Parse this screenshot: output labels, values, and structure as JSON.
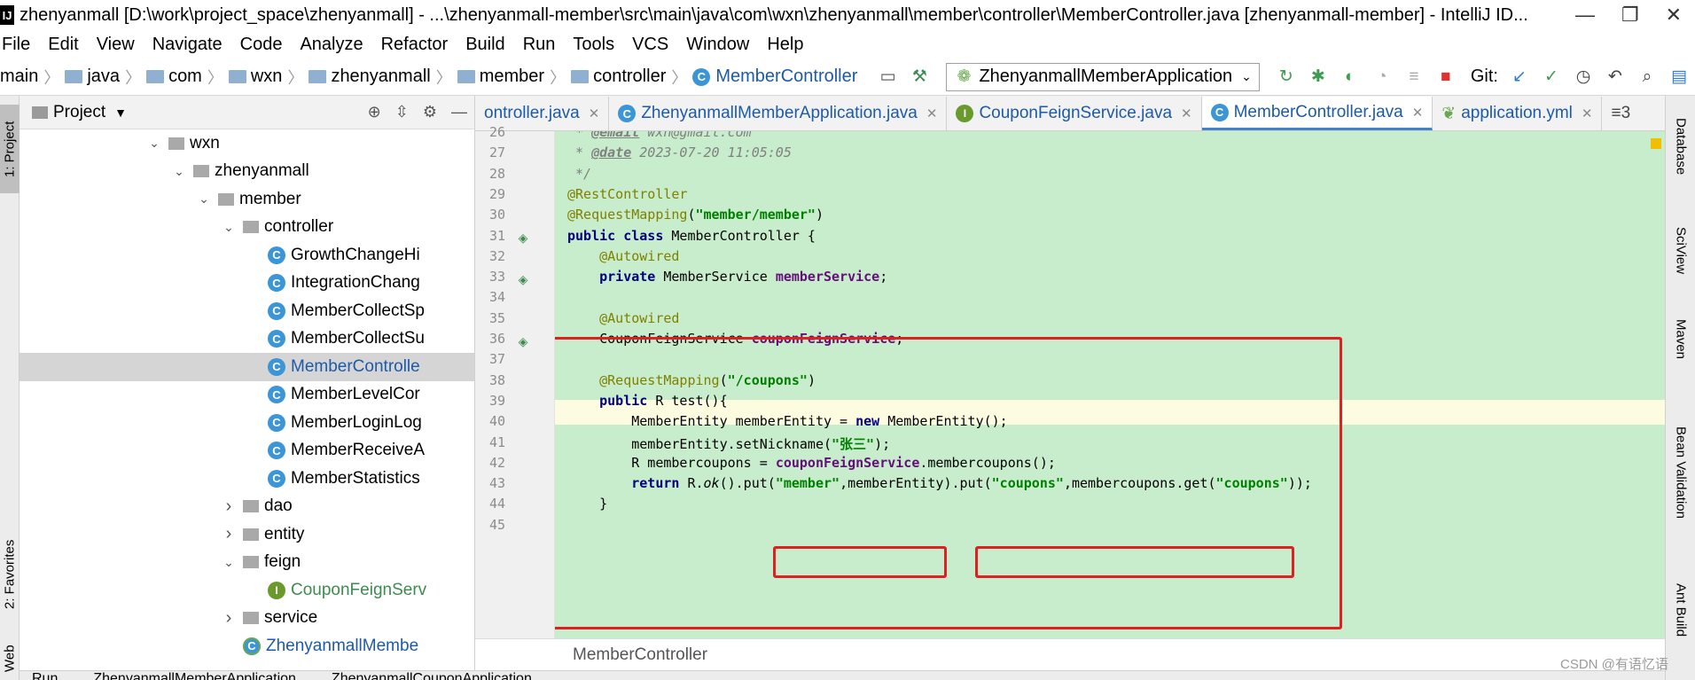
{
  "window": {
    "app_icon": "IJ",
    "title": "zhenyanmall [D:\\work\\project_space\\zhenyanmall] - ...\\zhenyanmall-member\\src\\main\\java\\com\\wxn\\zhenyanmall\\member\\controller\\MemberController.java [zhenyanmall-member] - IntelliJ ID...",
    "minimize": "—",
    "restore": "❐",
    "close": "✕"
  },
  "menu": [
    "File",
    "Edit",
    "View",
    "Navigate",
    "Code",
    "Analyze",
    "Refactor",
    "Build",
    "Run",
    "Tools",
    "VCS",
    "Window",
    "Help"
  ],
  "breadcrumbs": [
    "main",
    "java",
    "com",
    "wxn",
    "zhenyanmall",
    "member",
    "controller",
    "MemberController"
  ],
  "run_config": "ZhenyanmallMemberApplication",
  "git_label": "Git:",
  "project_panel": {
    "title": "Project",
    "tree": [
      {
        "label": "wxn",
        "indent": 1,
        "arrow": "down",
        "icon": "folder"
      },
      {
        "label": "zhenyanmall",
        "indent": 2,
        "arrow": "down",
        "icon": "folder"
      },
      {
        "label": "member",
        "indent": 3,
        "arrow": "down",
        "icon": "folder"
      },
      {
        "label": "controller",
        "indent": 4,
        "arrow": "down",
        "icon": "folder"
      },
      {
        "label": "GrowthChangeHi",
        "indent": 5,
        "arrow": "",
        "icon": "class"
      },
      {
        "label": "IntegrationChang",
        "indent": 5,
        "arrow": "",
        "icon": "class"
      },
      {
        "label": "MemberCollectSp",
        "indent": 5,
        "arrow": "",
        "icon": "class"
      },
      {
        "label": "MemberCollectSu",
        "indent": 5,
        "arrow": "",
        "icon": "class"
      },
      {
        "label": "MemberControlle",
        "indent": 5,
        "arrow": "",
        "icon": "class",
        "selected": true
      },
      {
        "label": "MemberLevelCor",
        "indent": 5,
        "arrow": "",
        "icon": "class"
      },
      {
        "label": "MemberLoginLog",
        "indent": 5,
        "arrow": "",
        "icon": "class"
      },
      {
        "label": "MemberReceiveA",
        "indent": 5,
        "arrow": "",
        "icon": "class"
      },
      {
        "label": "MemberStatistics",
        "indent": 5,
        "arrow": "",
        "icon": "class"
      },
      {
        "label": "dao",
        "indent": 4,
        "arrow": "right",
        "icon": "folder"
      },
      {
        "label": "entity",
        "indent": 4,
        "arrow": "right",
        "icon": "folder"
      },
      {
        "label": "feign",
        "indent": 4,
        "arrow": "down",
        "icon": "folder"
      },
      {
        "label": "CouponFeignServ",
        "indent": 5,
        "arrow": "",
        "icon": "interface"
      },
      {
        "label": "service",
        "indent": 4,
        "arrow": "right",
        "icon": "folder"
      },
      {
        "label": "ZhenyanmallMembe",
        "indent": 4,
        "arrow": "",
        "icon": "springclass"
      }
    ]
  },
  "left_tabs": {
    "project": "1: Project",
    "favorites": "2: Favorites",
    "web": "Web"
  },
  "editor_tabs": [
    {
      "label": "ontroller.java",
      "icon": "none",
      "active": false
    },
    {
      "label": "ZhenyanmallMemberApplication.java",
      "icon": "class",
      "active": false
    },
    {
      "label": "CouponFeignService.java",
      "icon": "interface",
      "active": false
    },
    {
      "label": "MemberController.java",
      "icon": "class",
      "active": true
    },
    {
      "label": "application.yml",
      "icon": "spring",
      "active": false
    }
  ],
  "tab_overflow": "≡3",
  "right_tabs": [
    "Database",
    "SciView",
    "Maven",
    "Bean Validation",
    "Ant Build"
  ],
  "code_lines": [
    {
      "n": "26",
      "html": "<span class=\"cmt\"> * <b><u>@email</u></b> wxn@gmail.com</span>"
    },
    {
      "n": "27",
      "html": "<span class=\"cmt\"> * <b><u>@date</u></b> 2023-07-20 11:05:05</span>"
    },
    {
      "n": "28",
      "html": "<span class=\"cmt\"> */</span>"
    },
    {
      "n": "29",
      "html": "<span class=\"ann\">@RestController</span>"
    },
    {
      "n": "30",
      "html": "<span class=\"ann\">@RequestMapping</span>(<span class=\"str\">\"member/member\"</span>)"
    },
    {
      "n": "31",
      "html": "<span class=\"kw\">public class</span> MemberController {"
    },
    {
      "n": "32",
      "html": "    <span class=\"ann\">@Autowired</span>"
    },
    {
      "n": "33",
      "html": "    <span class=\"kw\">private</span> MemberService <span class=\"fld\">memberService</span>;"
    },
    {
      "n": "34",
      "html": ""
    },
    {
      "n": "35",
      "html": "    <span class=\"ann\">@Autowired</span>"
    },
    {
      "n": "36",
      "html": "    CouponFeignService <span class=\"fld\">couponFeignService</span>;"
    },
    {
      "n": "37",
      "html": ""
    },
    {
      "n": "38",
      "html": "    <span class=\"ann\">@RequestMapping</span>(<span class=\"str\">\"/coupons\"</span>)"
    },
    {
      "n": "39",
      "html": "    <span class=\"kw\">public</span> R test(){"
    },
    {
      "n": "40",
      "html": "        MemberEntity memberEntity = <span class=\"kw\">new</span> MemberEntity();"
    },
    {
      "n": "41",
      "html": "        memberEntity.setNickname(<span class=\"str\">\"张三\"</span>);"
    },
    {
      "n": "42",
      "html": "        R membercoupons = <span class=\"fld\">couponFeignService</span>.membercoupons();"
    },
    {
      "n": "43",
      "html": "        <span class=\"kw\">return</span> R.<span class=\"mth\">ok</span>().put(<span class=\"str\">\"member\"</span>,memberEntity).put(<span class=\"str\">\"coupons\"</span>,membercoupons.get(<span class=\"str\">\"coupons\"</span>));"
    },
    {
      "n": "44",
      "html": "    }"
    },
    {
      "n": "45",
      "html": ""
    }
  ],
  "editor_breadcrumb": "MemberController",
  "bottom_tabs": [
    "Run",
    "ZhenyanmallMemberApplication",
    "ZhenyanmallCouponApplication"
  ],
  "watermark": "CSDN @有语忆语",
  "colors": {
    "editor_bg": "#c7edcc",
    "highlight_box": "#e02020",
    "current_line": "#fdfce0"
  }
}
